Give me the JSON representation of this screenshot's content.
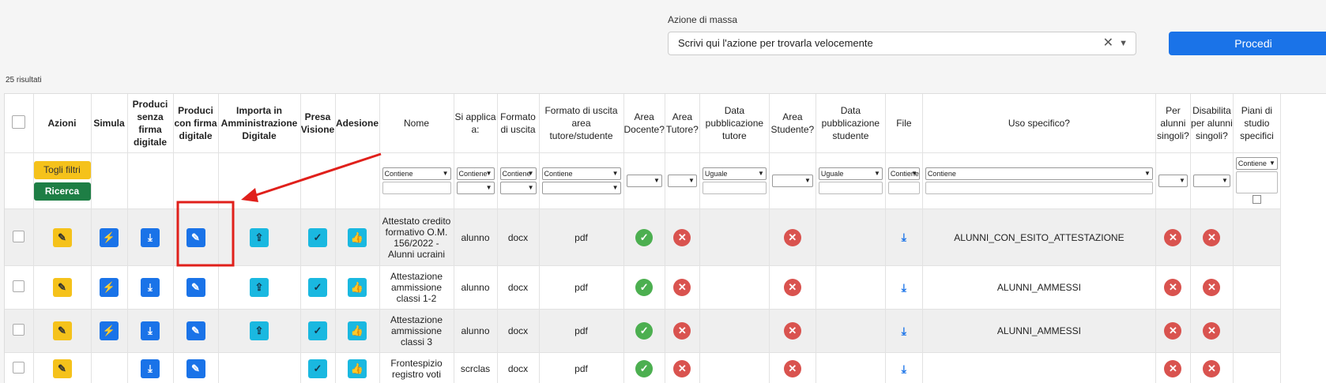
{
  "mass_action": {
    "label": "Azione di massa",
    "placeholder": "Scrivi qui l'azione per trovarla velocemente",
    "clear_icon": "close-icon",
    "dropdown_icon": "chevron-down-icon",
    "submit_label": "Procedi"
  },
  "results_count": "25 risultati",
  "headers": [
    "Azioni",
    "Simula",
    "Produci senza firma digitale",
    "Produci con firma digitale",
    "Importa in Amministrazione Digitale",
    "Presa Visione",
    "Adesione",
    "Nome",
    "Si applica a:",
    "Formato di uscita",
    "Formato di uscita area tutore/studente",
    "Area Docente?",
    "Area Tutore?",
    "Data pubblicazione tutore",
    "Area Studente?",
    "Data pubblicazione studente",
    "File",
    "Uso specifico?",
    "Per alunni singoli?",
    "Disabilita per alunni singoli?",
    "Piani di studio specifici"
  ],
  "filters": {
    "clear_label": "Togli filtri",
    "search_label": "Ricerca",
    "nome": "Contiene",
    "si_applica": "Contiene",
    "formato": "Contiene",
    "formato_tutore": "Contiene",
    "data_tutore": "Uguale",
    "data_studente": "Uguale",
    "file": "Contiene",
    "uso": "Contiene",
    "piani": "Contiene"
  },
  "rows": [
    {
      "nome": "Attestato credito formativo O.M. 156/2022 - Alunni ucraini",
      "si_applica": "alunno",
      "formato": "docx",
      "formato_tutore": "pdf",
      "uso": "ALUNNI_CON_ESITO_ATTESTAZIONE"
    },
    {
      "nome": "Attestazione ammissione classi 1-2",
      "si_applica": "alunno",
      "formato": "docx",
      "formato_tutore": "pdf",
      "uso": "ALUNNI_AMMESSI"
    },
    {
      "nome": "Attestazione ammissione classi 3",
      "si_applica": "alunno",
      "formato": "docx",
      "formato_tutore": "pdf",
      "uso": "ALUNNI_AMMESSI"
    },
    {
      "nome": "Frontespizio registro voti",
      "si_applica": "scrclas",
      "formato": "docx",
      "formato_tutore": "pdf",
      "uso": ""
    }
  ],
  "colors": {
    "primary": "#1a73e8",
    "warning": "#f5c21b",
    "success": "#4caf50",
    "danger": "#d9534f",
    "info": "#1ab8e0",
    "highlight": "#e0201b"
  }
}
